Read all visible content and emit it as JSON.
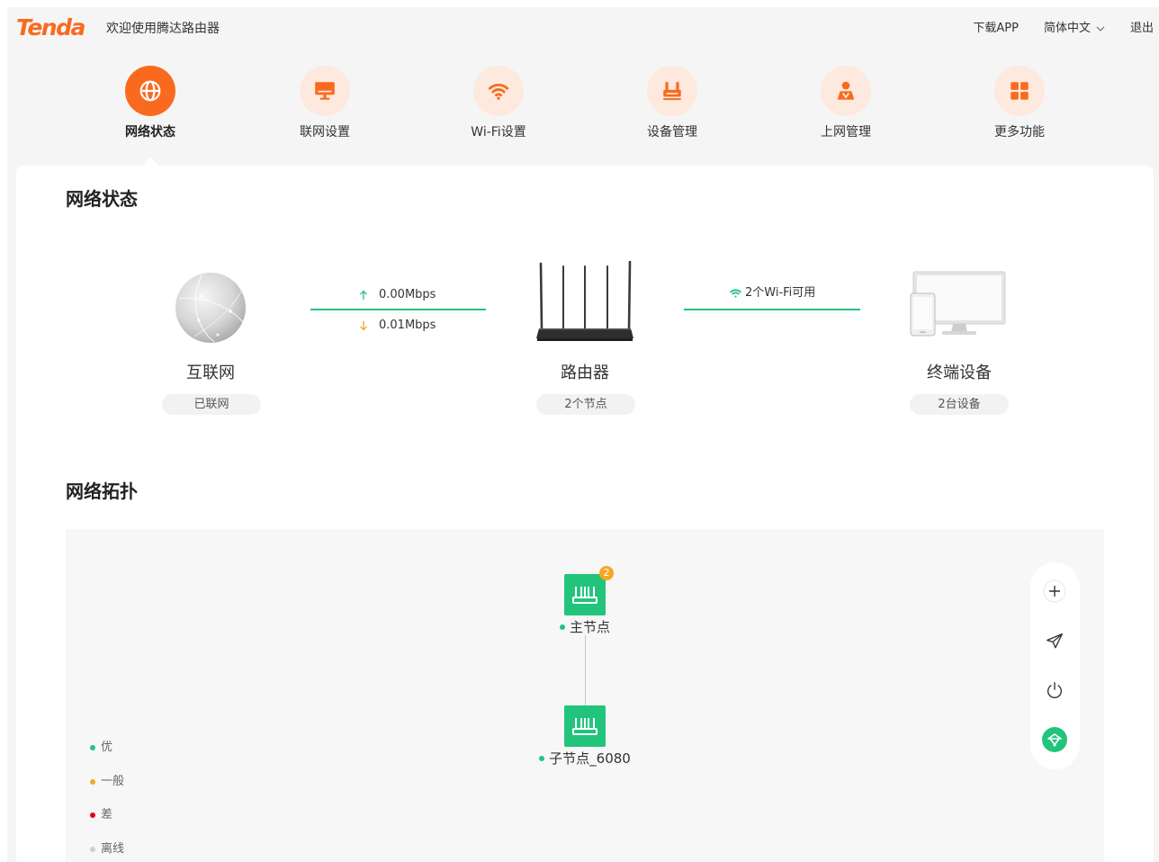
{
  "header": {
    "logo": "Tenda",
    "welcome": "欢迎使用腾达路由器",
    "download_app": "下载APP",
    "language": "简体中文",
    "logout": "退出"
  },
  "nav": {
    "items": [
      {
        "label": "网络状态",
        "icon": "globe-icon",
        "active": true
      },
      {
        "label": "联网设置",
        "icon": "monitor-icon",
        "active": false
      },
      {
        "label": "Wi-Fi设置",
        "icon": "wifi-icon",
        "active": false
      },
      {
        "label": "设备管理",
        "icon": "router-icon",
        "active": false
      },
      {
        "label": "上网管理",
        "icon": "user-shield-icon",
        "active": false
      },
      {
        "label": "更多功能",
        "icon": "grid-icon",
        "active": false
      }
    ]
  },
  "status": {
    "title": "网络状态",
    "internet": {
      "label": "互联网",
      "badge": "已联网",
      "icon": "globe-sphere-icon"
    },
    "upload_rate": "0.00Mbps",
    "download_rate": "0.01Mbps",
    "router": {
      "label": "路由器",
      "badge": "2个节点",
      "icon": "router-device-icon"
    },
    "wifi_available": "2个Wi-Fi可用",
    "devices": {
      "label": "终端设备",
      "badge": "2台设备",
      "icon": "monitor-phone-icon"
    }
  },
  "topology": {
    "title": "网络拓扑",
    "main_node": {
      "label": "主节点",
      "client_count": "2",
      "icon": "router-node-icon"
    },
    "sub_node": {
      "label": "子节点_6080",
      "icon": "router-node-icon"
    },
    "toolbar": [
      {
        "icon": "plus-icon"
      },
      {
        "icon": "send-icon"
      },
      {
        "icon": "power-icon"
      },
      {
        "icon": "mesh-icon"
      }
    ],
    "legend": [
      {
        "label": "优",
        "color": "#22c47c"
      },
      {
        "label": "一般",
        "color": "#f5a623"
      },
      {
        "label": "差",
        "color": "#e60012"
      },
      {
        "label": "离线",
        "color": "#cfcfcf"
      }
    ]
  },
  "colors": {
    "accent": "#fa6a1e",
    "accent_light": "#fde9de",
    "green": "#22c47c",
    "badge": "#f5a623",
    "download_arrow": "#f5a623"
  }
}
